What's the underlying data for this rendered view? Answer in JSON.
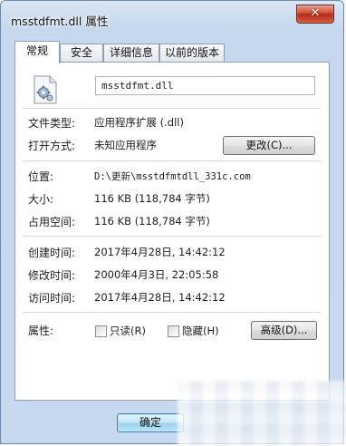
{
  "window": {
    "title": "msstdfmt.dll 属性",
    "close_label": "✕"
  },
  "tabs": [
    {
      "label": "常规",
      "active": true
    },
    {
      "label": "安全",
      "active": false
    },
    {
      "label": "详细信息",
      "active": false
    },
    {
      "label": "以前的版本",
      "active": false
    }
  ],
  "general": {
    "file_name": "msstdfmt.dll",
    "file_icon": "dll-file-icon",
    "type_label": "文件类型:",
    "type_value": "应用程序扩展 (.dll)",
    "opens_with_label": "打开方式:",
    "opens_with_value": "未知应用程序",
    "change_button": "更改(C)...",
    "location_label": "位置:",
    "location_value": "D:\\更新\\msstdfmtdll_331c.com",
    "size_label": "大小:",
    "size_value": "116 KB (118,784 字节)",
    "size_on_disk_label": "占用空间:",
    "size_on_disk_value": "116 KB (118,784 字节)",
    "created_label": "创建时间:",
    "created_value": "2017年4月28日, 14:42:12",
    "modified_label": "修改时间:",
    "modified_value": "2000年4月3日, 22:05:58",
    "accessed_label": "访问时间:",
    "accessed_value": "2017年4月28日, 14:42:12",
    "attributes_label": "属性:",
    "readonly_label": "只读(R)",
    "readonly_checked": false,
    "hidden_label": "隐藏(H)",
    "hidden_checked": false,
    "advanced_button": "高级(D)..."
  },
  "footer": {
    "ok_button": "确定"
  }
}
